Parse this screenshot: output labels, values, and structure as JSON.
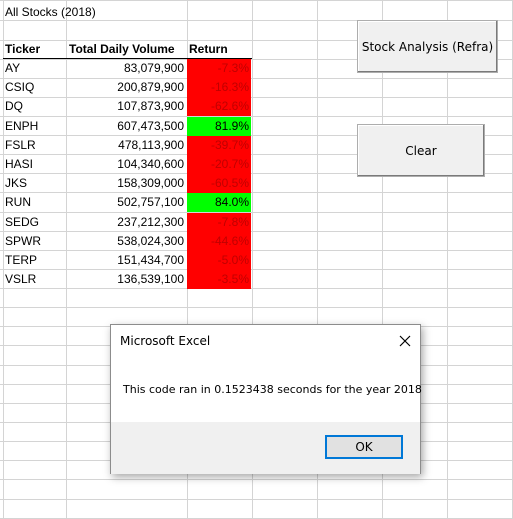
{
  "sheet": {
    "title": "All Stocks (2018)",
    "headers": {
      "ticker": "Ticker",
      "volume": "Total Daily Volume",
      "return": "Return"
    },
    "rows": [
      {
        "ticker": "AY",
        "volume": "83,079,900",
        "return": "-7.3%",
        "status": "negative"
      },
      {
        "ticker": "CSIQ",
        "volume": "200,879,900",
        "return": "-16.3%",
        "status": "negative"
      },
      {
        "ticker": "DQ",
        "volume": "107,873,900",
        "return": "-62.6%",
        "status": "negative"
      },
      {
        "ticker": "ENPH",
        "volume": "607,473,500",
        "return": "81.9%",
        "status": "positive"
      },
      {
        "ticker": "FSLR",
        "volume": "478,113,900",
        "return": "-39.7%",
        "status": "negative"
      },
      {
        "ticker": "HASI",
        "volume": "104,340,600",
        "return": "-20.7%",
        "status": "negative"
      },
      {
        "ticker": "JKS",
        "volume": "158,309,000",
        "return": "-60.5%",
        "status": "negative"
      },
      {
        "ticker": "RUN",
        "volume": "502,757,100",
        "return": "84.0%",
        "status": "positive"
      },
      {
        "ticker": "SEDG",
        "volume": "237,212,300",
        "return": "-7.8%",
        "status": "negative"
      },
      {
        "ticker": "SPWR",
        "volume": "538,024,300",
        "return": "-44.6%",
        "status": "negative"
      },
      {
        "ticker": "TERP",
        "volume": "151,434,700",
        "return": "-5.0%",
        "status": "negative"
      },
      {
        "ticker": "VSLR",
        "volume": "136,539,100",
        "return": "-3.5%",
        "status": "negative"
      }
    ]
  },
  "buttons": {
    "analysis_label": "Stock Analysis (Refra)",
    "clear_label": "Clear"
  },
  "dialog": {
    "title": "Microsoft Excel",
    "message": "This code ran in 0.1523438 seconds for the year 2018",
    "ok_label": "OK",
    "close_icon": "close-icon"
  },
  "colors": {
    "negative_fill": "#ff0000",
    "positive_fill": "#00ff00",
    "gridline": "#d4d4d4"
  }
}
